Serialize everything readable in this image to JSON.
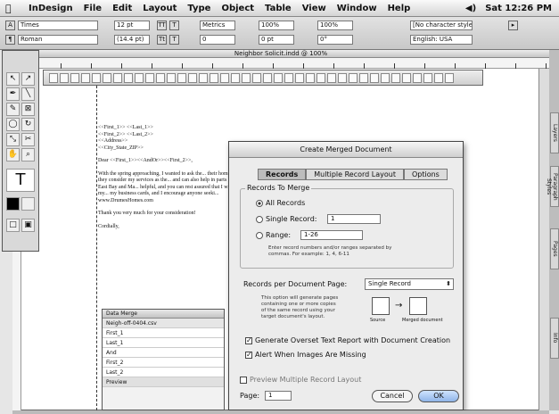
{
  "menubar": {
    "apple": "",
    "items": [
      "InDesign",
      "File",
      "Edit",
      "Layout",
      "Type",
      "Object",
      "Table",
      "View",
      "Window",
      "Help"
    ],
    "volume": "◀)",
    "clock": "Sat 12:26 PM"
  },
  "control_panel": {
    "font_family": "Times",
    "font_style": "Roman",
    "font_size": "12 pt",
    "leading": "(14.4 pt)",
    "kerning": "Metrics",
    "tracking": "0",
    "vscale": "100%",
    "hscale": "100%",
    "baseline": "0 pt",
    "skew": "0°",
    "char_style": "[No character style]",
    "language": "English: USA"
  },
  "document": {
    "title": "Neighbor Solicit.indd @ 100%"
  },
  "letter": {
    "address1": "<<First_1>> <<Last_1>>",
    "address2": "<<First_2>> <<Last_2>>",
    "address3": "<<Address>>",
    "address4": "<<City_State_ZIP>>",
    "salutation": "Dear <<First_1>><<AndOr>><<First_2>>,",
    "body": "With the spring approaching, I wanted to ask the... their home that they consider my services as the... and can also help in parts of the East Bay and Ma... helpful, and you can rest assured that I will do my... my business cards, and I encourage anyone seeki... www.DrumesHomes.com",
    "thanks": "Thank you very much for your consideration!",
    "closing": "Cordially,"
  },
  "data_merge_panel": {
    "title": "Data Merge",
    "source": "Neigh-off-0404.csv",
    "fields": [
      "First_1",
      "Last_1",
      "And",
      "First_2",
      "Last_2"
    ],
    "preview": "Preview"
  },
  "dialog": {
    "title": "Create Merged Document",
    "tabs": [
      "Records",
      "Multiple Record Layout",
      "Options"
    ],
    "records_to_merge": "Records To Merge",
    "all_records": "All Records",
    "single_record": "Single Record:",
    "single_value": "1",
    "range": "Range:",
    "range_value": "1-26",
    "range_note": "Enter record numbers and/or ranges separated by commas. For example: 1, 4, 6-11",
    "records_per_page_label": "Records per Document Page:",
    "records_per_page_value": "Single Record",
    "layout_note": "This option will generate pages containing one or more copies of the same record using your target document's layout.",
    "source_label": "Source",
    "merged_label": "Merged document",
    "overset": "Generate Overset Text Report with Document Creation",
    "images_missing": "Alert When Images Are Missing",
    "preview_layout": "Preview Multiple Record Layout",
    "page_label": "Page:",
    "page_value": "1",
    "cancel": "Cancel",
    "ok": "OK"
  },
  "right_tabs": [
    "Layers",
    "Paragraph Styles",
    "Pages",
    "Info"
  ]
}
